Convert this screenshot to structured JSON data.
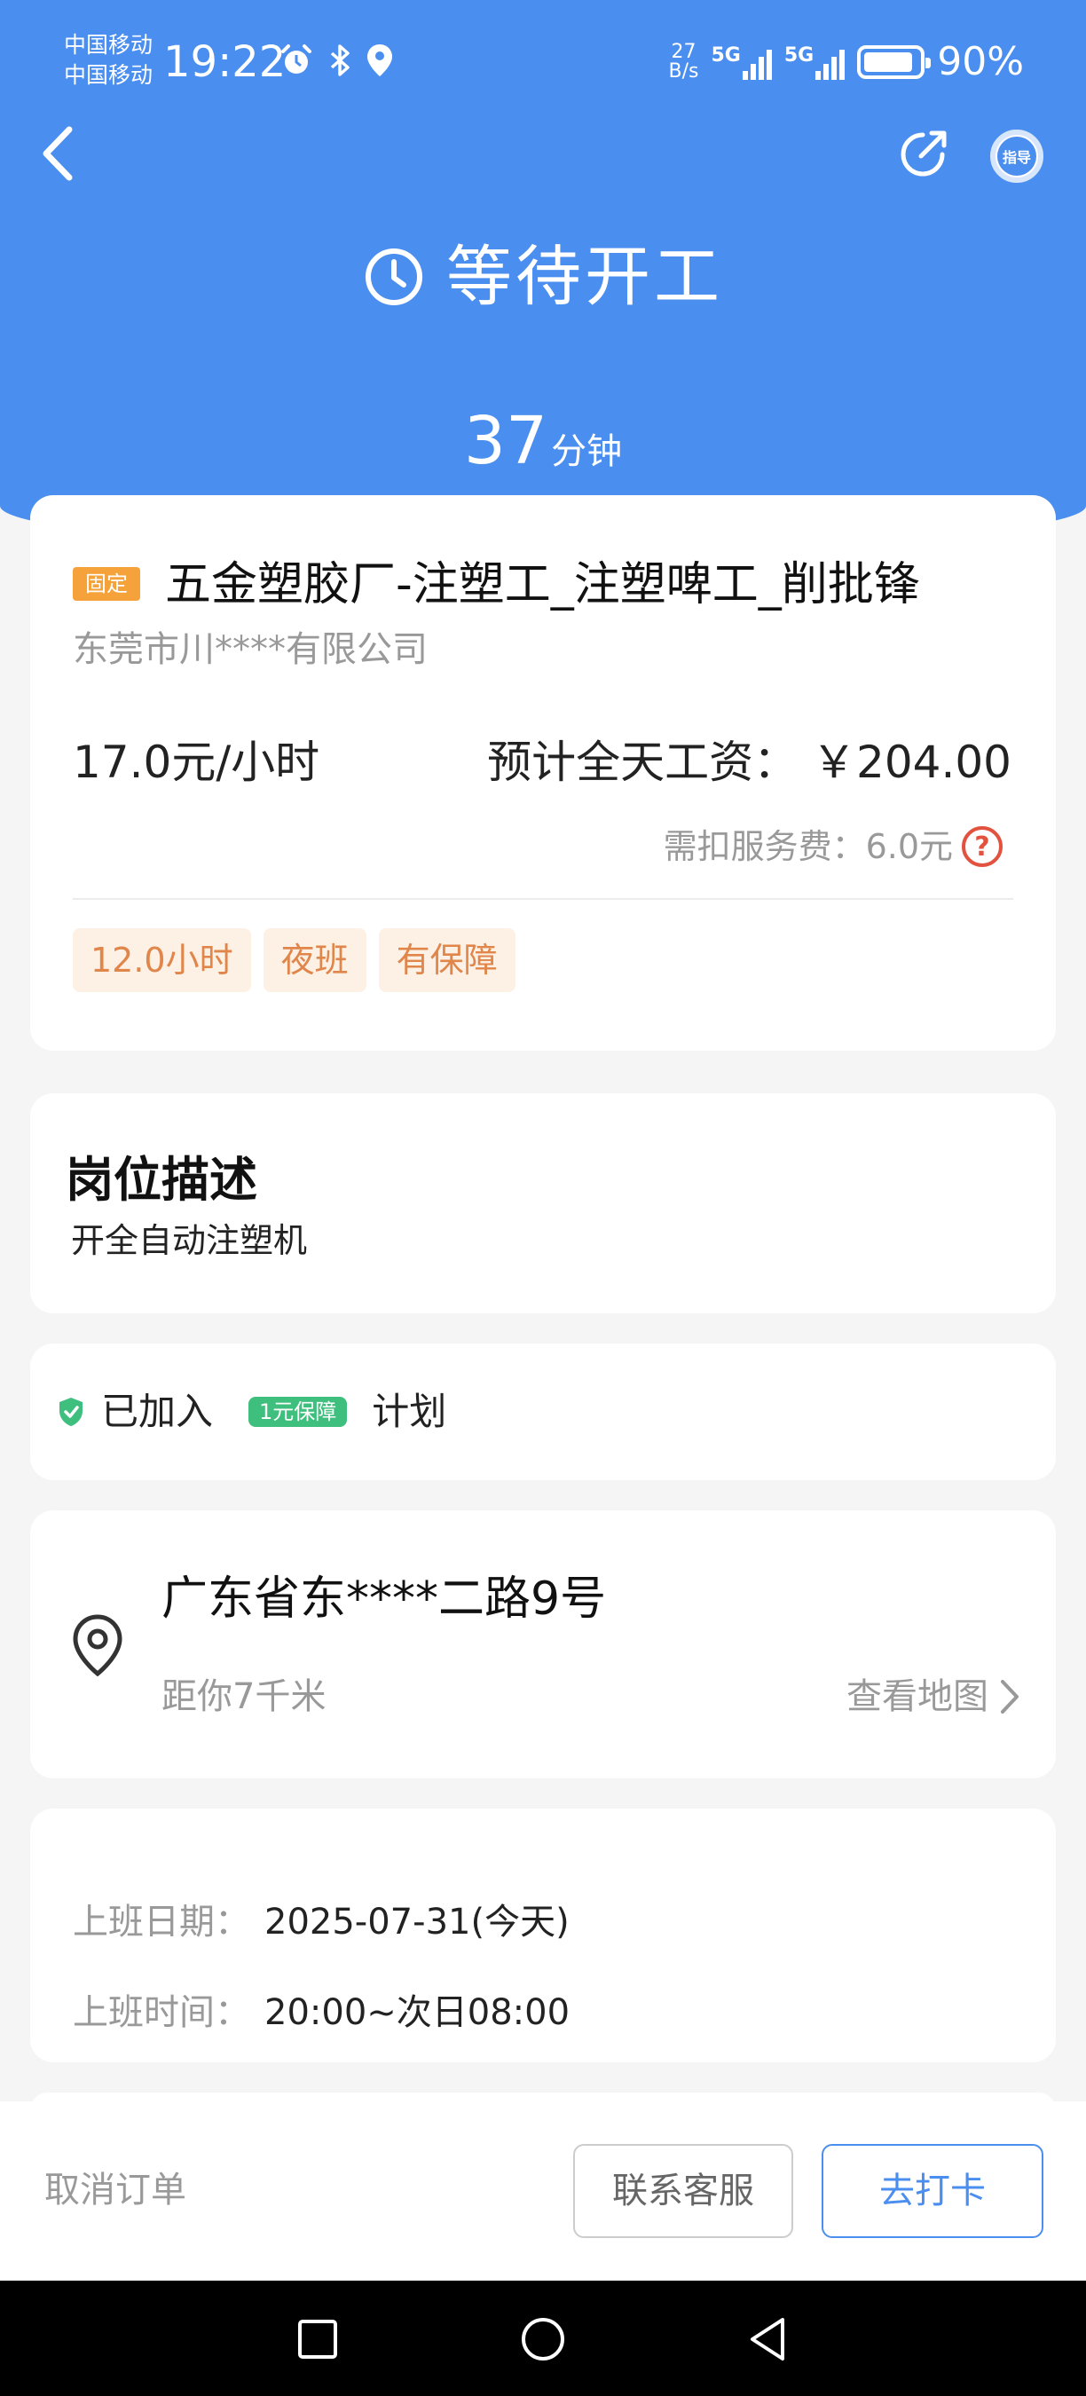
{
  "status_bar": {
    "carrier_1": "中国移动",
    "carrier_2": "中国移动",
    "time": "19:22",
    "net_speed_value": "27",
    "net_speed_unit": "B/s",
    "signal_1": "5G",
    "signal_2": "5G",
    "battery": "90%",
    "battery_level": 0.9
  },
  "header": {
    "status_title": "等待开工",
    "countdown_value": "37",
    "countdown_unit": "分钟",
    "guide_label": "指导"
  },
  "job": {
    "tag": "固定",
    "title": "五金塑胶厂-注塑工_注塑啤工_削批锋",
    "company": "东莞市川****有限公司",
    "wage": "17.0元/小时",
    "daily_pay": "预计全天工资： ￥204.00",
    "service_fee": "需扣服务费：6.0元",
    "help_icon": "?",
    "tags": [
      "12.0小时",
      "夜班",
      "有保障"
    ]
  },
  "description": {
    "title": "岗位描述",
    "body": "开全自动注塑机"
  },
  "guarantee": {
    "joined": "已加入",
    "badge": "1元保障",
    "plan": "计划"
  },
  "address": {
    "main": "广东省东****二路9号",
    "distance": "距你7千米",
    "view_map": "查看地图"
  },
  "schedule": {
    "date_label": "上班日期：",
    "date_value": "2025-07-31(今天)",
    "time_label": "上班时间：",
    "time_value": "20:00~次日08:00"
  },
  "footer": {
    "cancel": "取消订单",
    "contact": "联系客服",
    "clock_in": "去打卡"
  },
  "colors": {
    "header_blue": "#4a8ef0",
    "tag_orange": "#f6a23b",
    "chip_text": "#e0864a",
    "chip_bg": "#fdf0e4",
    "guarantee_green": "#3fbf7d",
    "help_red": "#e2533f"
  },
  "icons": {
    "status_left": [
      "alarm-icon",
      "bluetooth-icon",
      "location-icon"
    ],
    "header": [
      "back-arrow-icon",
      "share-icon",
      "guide-icon",
      "clock-icon"
    ],
    "content": [
      "shield-check-icon",
      "map-pin-icon",
      "chevron-right-icon",
      "help-icon"
    ],
    "nav": [
      "nav-recents-icon",
      "nav-home-icon",
      "nav-back-icon"
    ]
  }
}
